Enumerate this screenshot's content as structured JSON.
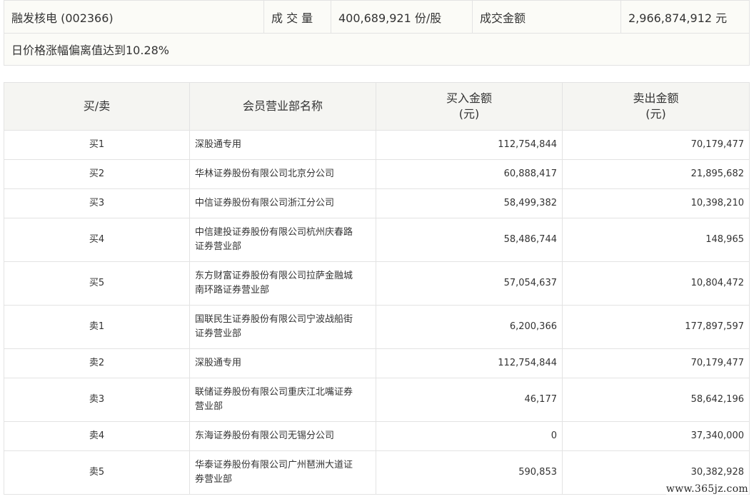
{
  "summary": {
    "stock": "融发核电 (002366)",
    "volume_label": "成 交 量",
    "volume_value": "400,689,921 份/股",
    "amount_label": "成交金额",
    "amount_value": "2,966,874,912 元",
    "reason": "日价格涨幅偏离值达到10.28%"
  },
  "table": {
    "headers": {
      "side": "买/卖",
      "broker": "会员营业部名称",
      "buy_line1": "买入金额",
      "buy_line2": "(元)",
      "sell_line1": "卖出金额",
      "sell_line2": "(元)"
    },
    "rows": [
      {
        "side": "买1",
        "broker": "深股通专用",
        "buy": "112,754,844",
        "sell": "70,179,477"
      },
      {
        "side": "买2",
        "broker": "华林证券股份有限公司北京分公司",
        "buy": "60,888,417",
        "sell": "21,895,682"
      },
      {
        "side": "买3",
        "broker": "中信证券股份有限公司浙江分公司",
        "buy": "58,499,382",
        "sell": "10,398,210"
      },
      {
        "side": "买4",
        "broker_line1": "中信建投证券股份有限公司杭州庆春路",
        "broker_line2": "证券营业部",
        "buy": "58,486,744",
        "sell": "148,965"
      },
      {
        "side": "买5",
        "broker_line1": "东方财富证券股份有限公司拉萨金融城",
        "broker_line2": "南环路证券营业部",
        "buy": "57,054,637",
        "sell": "10,804,472"
      },
      {
        "side": "卖1",
        "broker_line1": "国联民生证券股份有限公司宁波战船街",
        "broker_line2": "证券营业部",
        "buy": "6,200,366",
        "sell": "177,897,597"
      },
      {
        "side": "卖2",
        "broker": "深股通专用",
        "buy": "112,754,844",
        "sell": "70,179,477"
      },
      {
        "side": "卖3",
        "broker_line1": "联储证券股份有限公司重庆江北嘴证券",
        "broker_line2": "营业部",
        "buy": "46,177",
        "sell": "58,642,196"
      },
      {
        "side": "卖4",
        "broker": "东海证券股份有限公司无锡分公司",
        "buy": "0",
        "sell": "37,340,000"
      },
      {
        "side": "卖5",
        "broker_line1": "华泰证券股份有限公司广州琶洲大道证",
        "broker_line2": "券营业部",
        "buy": "590,853",
        "sell": "30,382,928"
      }
    ]
  },
  "watermark": "www.365jz.com"
}
